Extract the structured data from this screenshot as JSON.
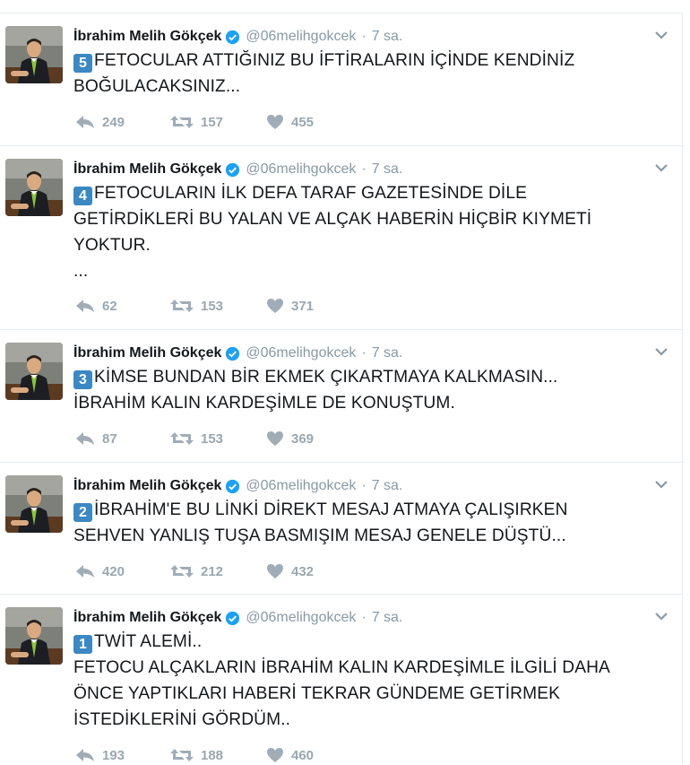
{
  "colors": {
    "verified": "#1da1f2",
    "number_badge": "#3b88c3",
    "muted": "#8899a6"
  },
  "tweets": [
    {
      "name": "İbrahim Melih Gökçek",
      "handle": "@06melihgokcek",
      "time": "7 sa.",
      "number": "5",
      "text": "FETOCULAR ATTIĞINIZ BU İFTİRALARIN İÇİNDE KENDİNİZ\nBOĞULACAKSINIZ...",
      "replies": "249",
      "retweets": "157",
      "likes": "455"
    },
    {
      "name": "İbrahim Melih Gökçek",
      "handle": "@06melihgokcek",
      "time": "7 sa.",
      "number": "4",
      "text": "FETOCULARIN İLK DEFA TARAF GAZETESİNDE DİLE\nGETİRDİKLERİ BU YALAN VE ALÇAK HABERİN HİÇBİR KIYMETİ\nYOKTUR.\n...",
      "replies": "62",
      "retweets": "153",
      "likes": "371"
    },
    {
      "name": "İbrahim Melih Gökçek",
      "handle": "@06melihgokcek",
      "time": "7 sa.",
      "number": "3",
      "text": "KİMSE BUNDAN BİR EKMEK ÇIKARTMAYA KALKMASIN...\nİBRAHİM KALIN KARDEŞİMLE DE KONUŞTUM.",
      "replies": "87",
      "retweets": "153",
      "likes": "369"
    },
    {
      "name": "İbrahim Melih Gökçek",
      "handle": "@06melihgokcek",
      "time": "7 sa.",
      "number": "2",
      "text": "İBRAHİM'E BU LİNKİ DİREKT MESAJ ATMAYA ÇALIŞIRKEN\nSEHVEN YANLIŞ TUŞA BASMIŞIM MESAJ GENELE DÜŞTÜ...",
      "replies": "420",
      "retweets": "212",
      "likes": "432"
    },
    {
      "name": "İbrahim Melih Gökçek",
      "handle": "@06melihgokcek",
      "time": "7 sa.",
      "number": "1",
      "text": "TWİT ALEMİ..\nFETOCU ALÇAKLARIN İBRAHİM KALIN KARDEŞİMLE İLGİLİ DAHA\nÖNCE YAPTIKLARI HABERİ TEKRAR GÜNDEME GETİRMEK\nİSTEDİKLERİNİ GÖRDÜM..",
      "replies": "193",
      "retweets": "188",
      "likes": "460"
    }
  ]
}
